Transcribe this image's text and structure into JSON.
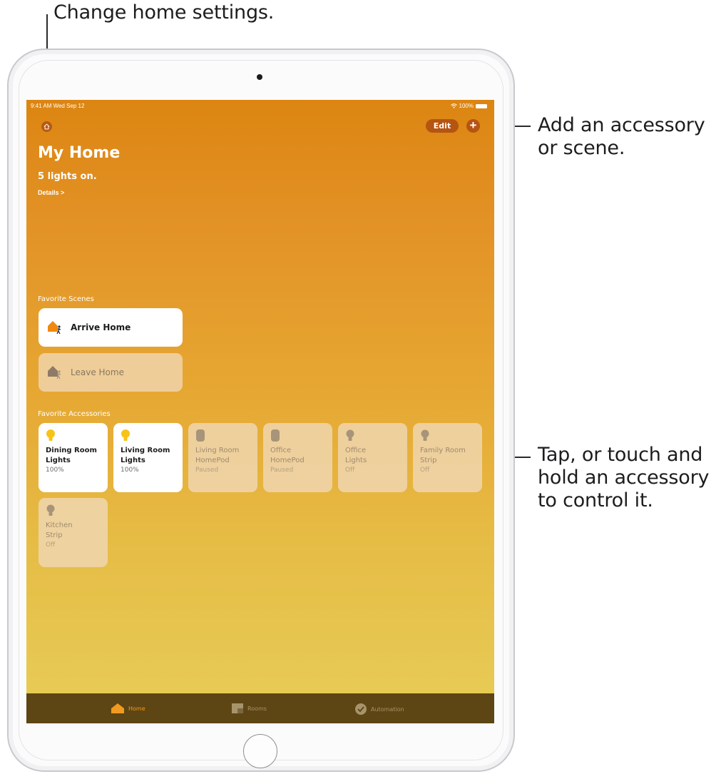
{
  "callouts": {
    "top": "Change home settings.",
    "right_top": [
      "Add an accessory",
      "or scene."
    ],
    "right_middle": [
      "Tap, or touch and",
      "hold an accessory",
      "to control it."
    ]
  },
  "status_bar": {
    "time": "9:41 AM  Wed Sep 12",
    "battery": "100%"
  },
  "header": {
    "edit_label": "Edit",
    "plus_label": "+"
  },
  "home": {
    "title": "My Home",
    "subtitle": "5 lights on.",
    "details_link": "Details >"
  },
  "scenes": {
    "label": "Favorite Scenes",
    "items": [
      {
        "label": "Arrive Home",
        "active": true
      },
      {
        "label": "Leave Home",
        "active": false
      }
    ]
  },
  "accessories": {
    "label": "Favorite Accessories",
    "items": [
      {
        "name": "Dining Room\nLights",
        "state": "100%",
        "on": true,
        "icon": "bulb-icon"
      },
      {
        "name": "Living Room\nLights",
        "state": "100%",
        "on": true,
        "icon": "bulb-icon"
      },
      {
        "name": "Living Room\nHomePod",
        "state": "Paused",
        "on": false,
        "icon": "homepod-icon"
      },
      {
        "name": "Office\nHomePod",
        "state": "Paused",
        "on": false,
        "icon": "homepod-icon"
      },
      {
        "name": "Office\nLights",
        "state": "Off",
        "on": false,
        "icon": "bulb-icon"
      },
      {
        "name": "Family Room\nStrip",
        "state": "Off",
        "on": false,
        "icon": "bulb-icon"
      },
      {
        "name": "Kitchen\nStrip",
        "state": "Off",
        "on": false,
        "icon": "bulb-icon"
      }
    ]
  },
  "tabbar": {
    "items": [
      {
        "label": "Home",
        "active": true
      },
      {
        "label": "Rooms",
        "active": false
      },
      {
        "label": "Automation",
        "active": false
      }
    ]
  },
  "colors": {
    "accent_orange": "#f19a20",
    "gradient_top": "#dc8512",
    "gradient_bottom": "#e7cd57",
    "tabbar_bg": "#5e4514"
  }
}
